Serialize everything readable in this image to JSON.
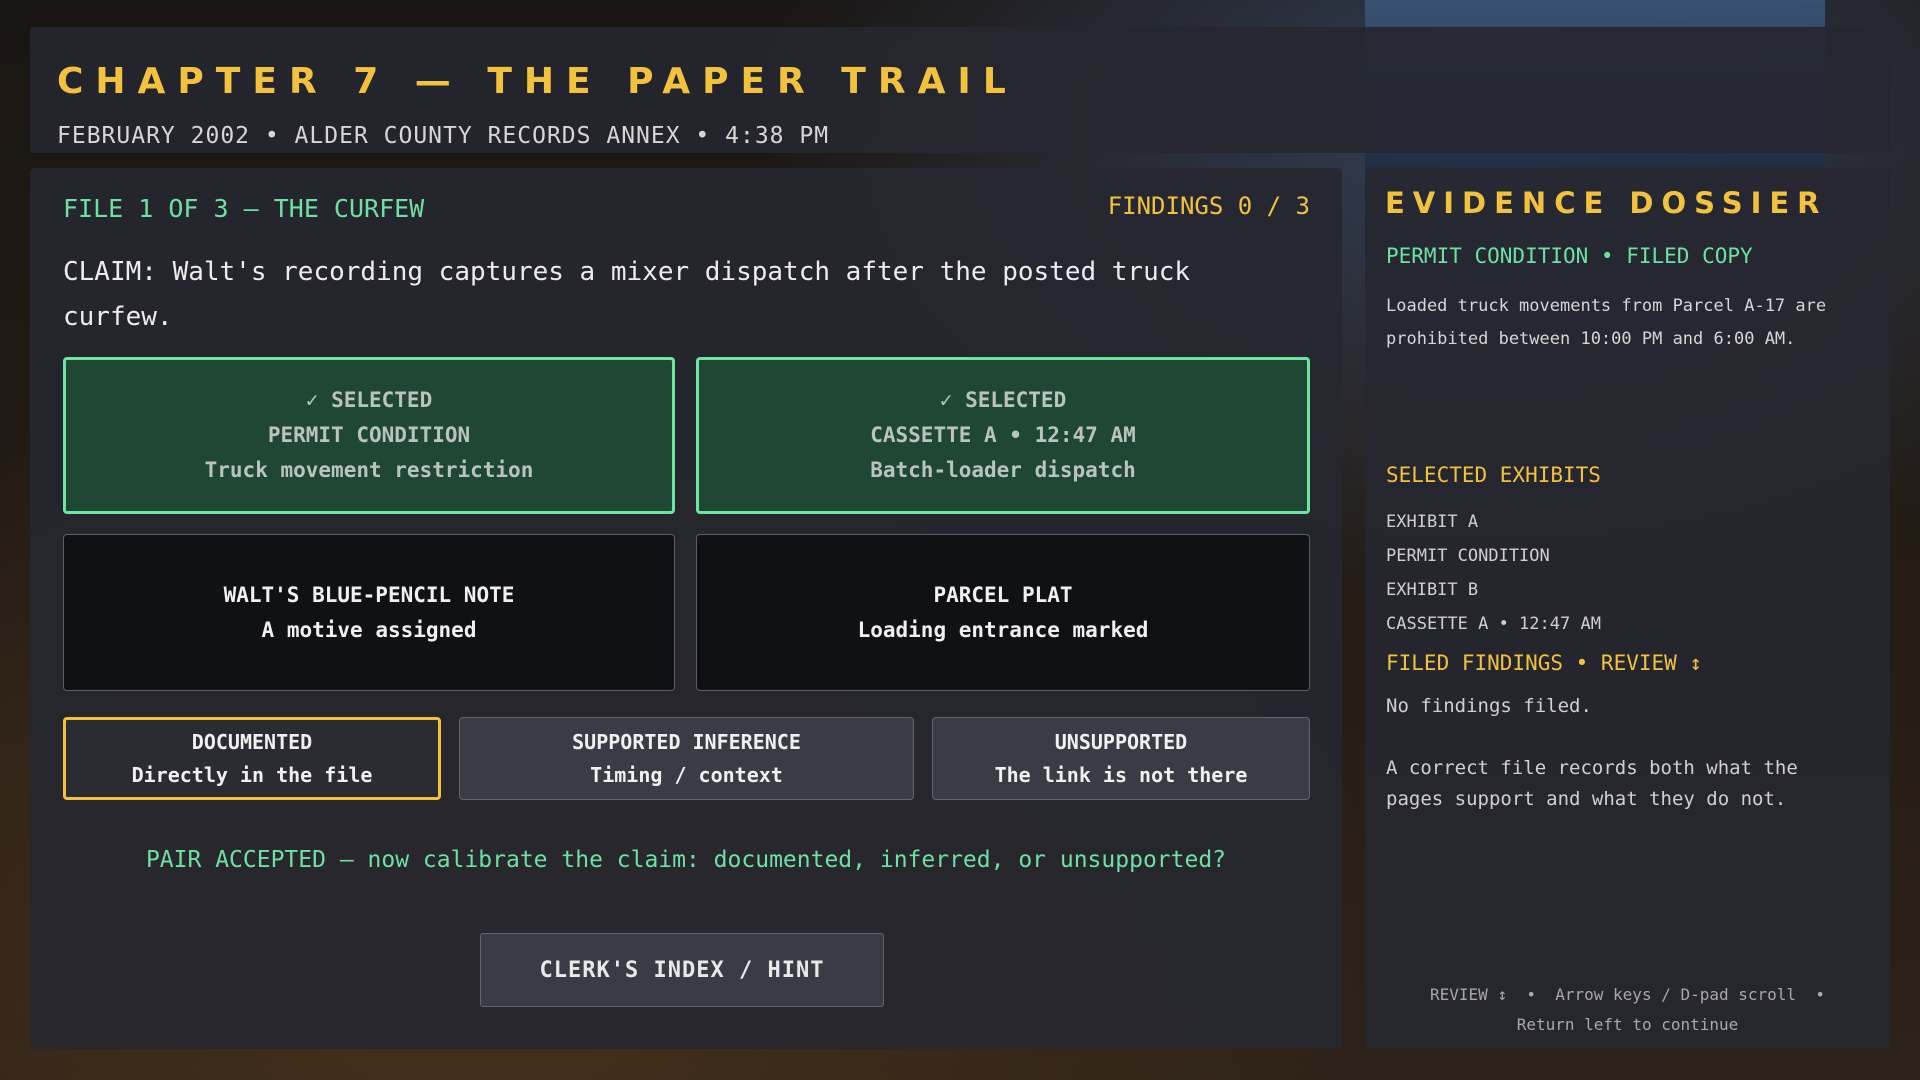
{
  "header": {
    "chapter_title": "CHAPTER 7 — THE PAPER TRAIL",
    "subtitle": "FEBRUARY 2002 • ALDER COUNTY RECORDS ANNEX • 4:38 PM"
  },
  "main": {
    "file_label": "FILE 1 OF 3 — THE CURFEW",
    "findings_count": "FINDINGS 0 / 3",
    "claim": "CLAIM: Walt's recording captures a mixer dispatch after the posted truck curfew.",
    "evidence_cards": [
      {
        "state": "✓ SELECTED",
        "title": "PERMIT CONDITION",
        "detail": "Truck movement restriction",
        "selected": true
      },
      {
        "state": "✓ SELECTED",
        "title": "CASSETTE A • 12:47 AM",
        "detail": "Batch-loader dispatch",
        "selected": true
      },
      {
        "title": "WALT'S BLUE-PENCIL NOTE",
        "detail": "A motive assigned",
        "selected": false
      },
      {
        "title": "PARCEL PLAT",
        "detail": "Loading entrance marked",
        "selected": false
      }
    ],
    "calibration_options": [
      {
        "title": "DOCUMENTED",
        "detail": "Directly in the file",
        "active": true
      },
      {
        "title": "SUPPORTED INFERENCE",
        "detail": "Timing / context",
        "active": false
      },
      {
        "title": "UNSUPPORTED",
        "detail": "The link is not there",
        "active": false
      }
    ],
    "status_message": "PAIR ACCEPTED — now calibrate the claim: documented, inferred, or unsupported?",
    "hint_button_label": "CLERK'S INDEX / HINT"
  },
  "dossier": {
    "title": "EVIDENCE DOSSIER",
    "permit_heading": "PERMIT CONDITION • FILED COPY",
    "permit_text": "Loaded truck movements from Parcel A-17 are prohibited between 10:00 PM and 6:00 AM.",
    "selected_heading": "SELECTED EXHIBITS",
    "exhibits": [
      {
        "label": "EXHIBIT A",
        "value": "PERMIT CONDITION"
      },
      {
        "label": "EXHIBIT B",
        "value": "CASSETTE A • 12:47 AM"
      }
    ],
    "filed_heading": "FILED FINDINGS • REVIEW ↕",
    "no_findings": "No findings filed.",
    "filed_note": "A correct file records both what the pages support and what they do not.",
    "controls_line1": "REVIEW ↕  •  Arrow keys / D-pad scroll  •",
    "controls_line2": "Return left to continue"
  },
  "colors": {
    "accent_gold": "#f2c23f",
    "accent_green": "#6fe0a4",
    "selected_card_bg": "#1f4734"
  }
}
